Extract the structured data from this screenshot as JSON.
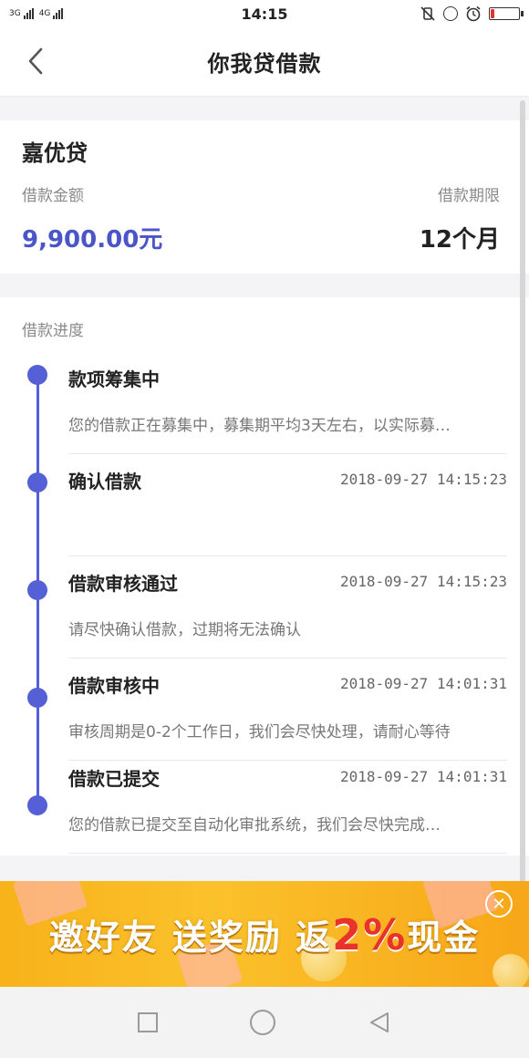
{
  "status_bar": {
    "network_left": "3G",
    "network_right": "4G",
    "time": "14:15",
    "battery_level": 0.12,
    "battery_color": "#e33333"
  },
  "nav": {
    "back_icon": "chevron-left-icon",
    "title": "你我贷借款"
  },
  "loan": {
    "lender": "嘉优贷",
    "amount_label": "借款金额",
    "term_label": "借款期限",
    "amount_value": "9,900.00元",
    "term_value": "12个月",
    "accent_color": "#4a55c8"
  },
  "progress": {
    "title": "借款进度",
    "timeline_color": "#5660d6",
    "steps": [
      {
        "title": "款项筹集中",
        "time": "",
        "desc": "您的借款正在募集中，募集期平均3天左右，以实际募…"
      },
      {
        "title": "确认借款",
        "time": "2018-09-27 14:15:23",
        "desc": ""
      },
      {
        "title": "借款审核通过",
        "time": "2018-09-27 14:15:23",
        "desc": "请尽快确认借款，过期将无法确认"
      },
      {
        "title": "借款审核中",
        "time": "2018-09-27 14:01:31",
        "desc": "审核周期是0-2个工作日，我们会尽快处理，请耐心等待"
      },
      {
        "title": "借款已提交",
        "time": "2018-09-27 14:01:31",
        "desc": "您的借款已提交至自动化审批系统，我们会尽快完成…"
      }
    ]
  },
  "banner": {
    "text_part1": "邀好友 送奖励 返",
    "text_accent": "2%",
    "text_part2": "现金",
    "close_icon": "close-circle-icon",
    "close_glyph": "✕"
  },
  "system_nav": {
    "recent_icon": "square-icon",
    "home_icon": "circle-icon",
    "back_icon": "triangle-back-icon"
  }
}
